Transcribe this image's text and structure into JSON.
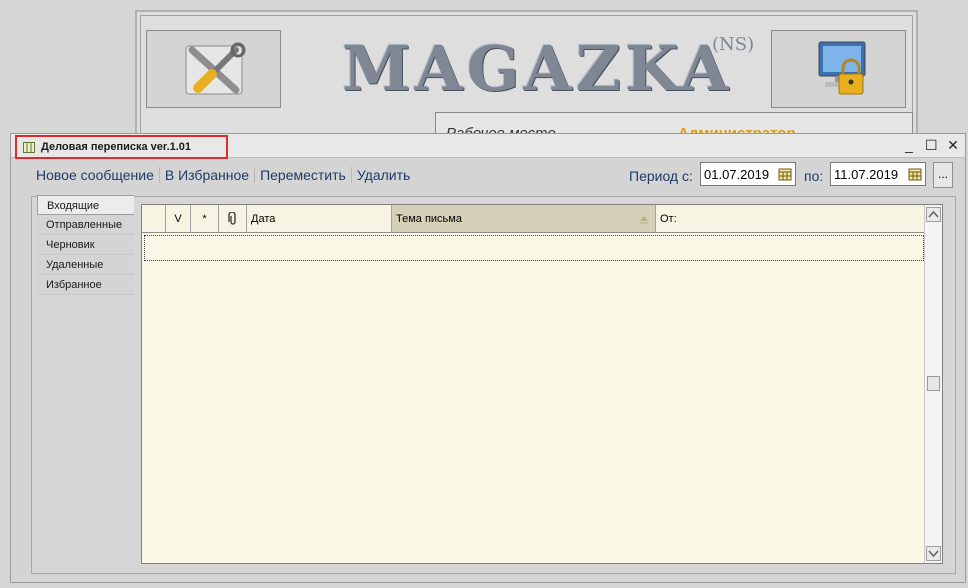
{
  "background_app": {
    "logo_text": "MAGAZKA",
    "logo_superscript": "(NS)",
    "workplace_label": "Рабочее место",
    "workplace_value": "Администратор"
  },
  "window": {
    "title": "Деловая переписка ver.1.01",
    "controls": {
      "minimize": "_",
      "maximize": "☐",
      "close": "✕"
    }
  },
  "toolbar": {
    "new_message": "Новое сообщение",
    "to_favorites": "В Избранное",
    "move": "Переместить",
    "delete": "Удалить"
  },
  "period": {
    "from_label": "Период с:",
    "from_value": "01.07.2019",
    "to_label": "по:",
    "to_value": "11.07.2019",
    "more": "..."
  },
  "folders": [
    "Входящие",
    "Отправленные",
    "Черновик",
    "Удаленные",
    "Избранное"
  ],
  "grid": {
    "columns": {
      "check": "V",
      "star": "*",
      "date": "Дата",
      "subject": "Тема письма",
      "from": "От:"
    }
  },
  "colors": {
    "title_highlight": "#e02b2b",
    "grid_bg": "#fbf8e8",
    "link_text": "#1f3b66",
    "workplace_value": "#d99b1c"
  }
}
